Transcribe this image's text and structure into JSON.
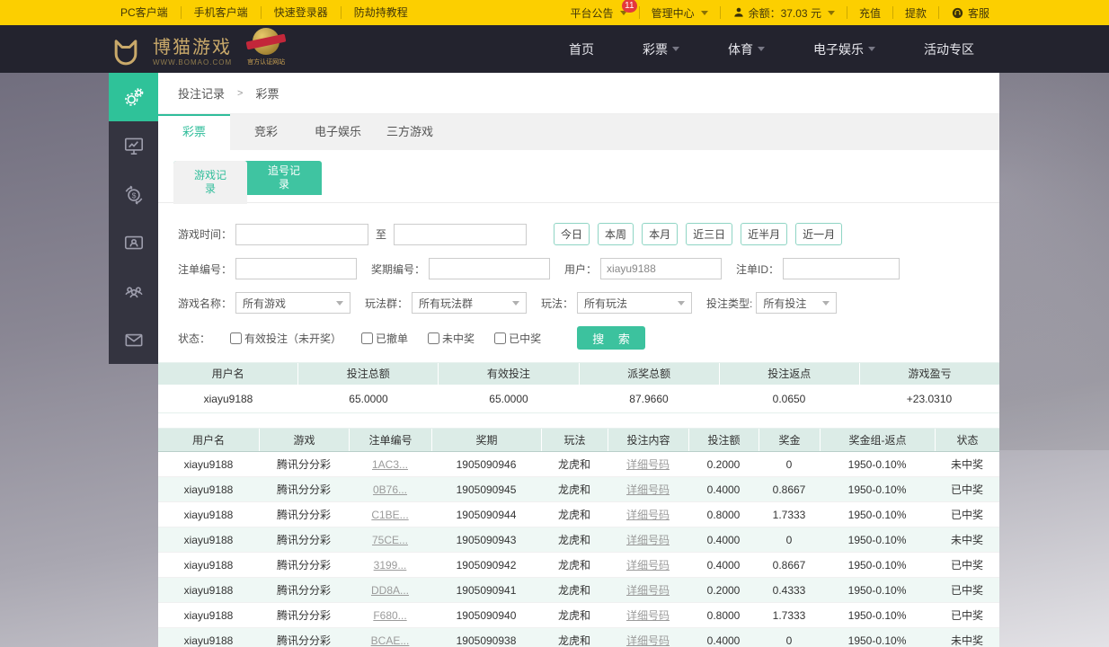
{
  "colors": {
    "accent": "#2fbd9a",
    "topbar": "#fccf00",
    "header_bg": "#23232e",
    "sidebar_active": "#2fc299",
    "table_header_bg": "#dcece7",
    "row_alt": "#eff8f5",
    "badge_red": "#e4393c",
    "link_gray": "#9b9b9b"
  },
  "topbar": {
    "left_links": [
      "PC客户端",
      "手机客户端",
      "快速登录器",
      "防劫持教程"
    ],
    "announcement": {
      "label": "平台公告",
      "badge": "11"
    },
    "management_label": "管理中心",
    "balance_label": "余额：37.03 元",
    "recharge_label": "充值",
    "withdraw_label": "提款",
    "service_label": "客服"
  },
  "header": {
    "logo_title": "博猫游戏",
    "logo_subtitle": "WWW.BOMAO.COM",
    "cert_label": "官方认证网站",
    "nav": [
      {
        "label": "首页"
      },
      {
        "label": "彩票"
      },
      {
        "label": "体育"
      },
      {
        "label": "电子娱乐"
      },
      {
        "label": "活动专区"
      }
    ]
  },
  "sidebar": {
    "icons": [
      "gears",
      "monitor-chart",
      "money-refresh",
      "member-card",
      "agents",
      "mail"
    ]
  },
  "breadcrumb": {
    "root": "投注记录",
    "sep": ">",
    "current": "彩票"
  },
  "tabs": {
    "items": [
      "彩票",
      "竞彩",
      "电子娱乐",
      "三方游戏"
    ],
    "active": "彩票"
  },
  "subtabs": {
    "items": [
      "游戏记录",
      "追号记录"
    ],
    "active": "游戏记录"
  },
  "filters": {
    "game_time_label": "游戏时间：",
    "to_label": "至",
    "quick_buttons": [
      "今日",
      "本周",
      "本月",
      "近三日",
      "近半月",
      "近一月"
    ],
    "order_no_label": "注单编号：",
    "issue_no_label": "奖期编号：",
    "user_label": "用户：",
    "user_value": "xiayu9188",
    "order_id_label": "注单ID：",
    "game_name_label": "游戏名称：",
    "game_name_value": "所有游戏",
    "play_group_label": "玩法群：",
    "play_group_value": "所有玩法群",
    "play_label": "玩法：",
    "play_value": "所有玩法",
    "bet_type_label": "投注类型:",
    "bet_type_value": "所有投注",
    "status_label": "状态：",
    "status_options": [
      "有效投注（未开奖）",
      "已撤单",
      "未中奖",
      "已中奖"
    ],
    "search_label": "搜 索"
  },
  "summary": {
    "headers": [
      "用户名",
      "投注总额",
      "有效投注",
      "派奖总额",
      "投注返点",
      "游戏盈亏"
    ],
    "row": [
      "xiayu9188",
      "65.0000",
      "65.0000",
      "87.9660",
      "0.0650",
      "+23.0310"
    ]
  },
  "table": {
    "headers": [
      "用户名",
      "游戏",
      "注单编号",
      "奖期",
      "玩法",
      "投注内容",
      "投注额",
      "奖金",
      "奖金组-返点",
      "状态"
    ],
    "rows": [
      [
        "xiayu9188",
        "腾讯分分彩",
        "1AC3...",
        "1905090946",
        "龙虎和",
        "详细号码",
        "0.2000",
        "0",
        "1950-0.10%",
        "未中奖"
      ],
      [
        "xiayu9188",
        "腾讯分分彩",
        "0B76...",
        "1905090945",
        "龙虎和",
        "详细号码",
        "0.4000",
        "0.8667",
        "1950-0.10%",
        "已中奖"
      ],
      [
        "xiayu9188",
        "腾讯分分彩",
        "C1BE...",
        "1905090944",
        "龙虎和",
        "详细号码",
        "0.8000",
        "1.7333",
        "1950-0.10%",
        "已中奖"
      ],
      [
        "xiayu9188",
        "腾讯分分彩",
        "75CE...",
        "1905090943",
        "龙虎和",
        "详细号码",
        "0.4000",
        "0",
        "1950-0.10%",
        "未中奖"
      ],
      [
        "xiayu9188",
        "腾讯分分彩",
        "3199...",
        "1905090942",
        "龙虎和",
        "详细号码",
        "0.4000",
        "0.8667",
        "1950-0.10%",
        "已中奖"
      ],
      [
        "xiayu9188",
        "腾讯分分彩",
        "DD8A...",
        "1905090941",
        "龙虎和",
        "详细号码",
        "0.2000",
        "0.4333",
        "1950-0.10%",
        "已中奖"
      ],
      [
        "xiayu9188",
        "腾讯分分彩",
        "F680...",
        "1905090940",
        "龙虎和",
        "详细号码",
        "0.8000",
        "1.7333",
        "1950-0.10%",
        "已中奖"
      ],
      [
        "xiayu9188",
        "腾讯分分彩",
        "BCAE...",
        "1905090938",
        "龙虎和",
        "详细号码",
        "0.4000",
        "0",
        "1950-0.10%",
        "未中奖"
      ]
    ]
  }
}
